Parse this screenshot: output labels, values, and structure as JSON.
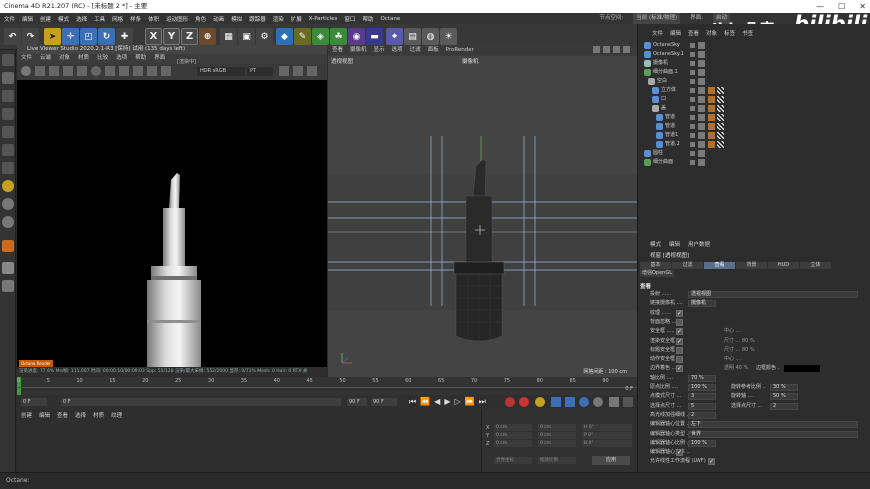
{
  "window": {
    "title": "Cinema 4D R21.207 (RC) - [未标题 2 *] - 主要",
    "controls": [
      "—",
      "☐",
      "✕"
    ]
  },
  "menubar": {
    "items": [
      "文件",
      "编辑",
      "创建",
      "模式",
      "选择",
      "工具",
      "网格",
      "样条",
      "体积",
      "运动图形",
      "角色",
      "动画",
      "模拟",
      "跟踪器",
      "渲染",
      "扩展",
      "X-Particles",
      "窗口",
      "帮助",
      "Octane"
    ],
    "layout_label": "节点空间:",
    "layout_value": "当前 (标准/物理)",
    "interface_label": "界面:",
    "interface_value": "启动"
  },
  "watermark": {
    "brand": "Jidu几度",
    "site": "bilibili"
  },
  "viewer": {
    "title": "Live Viewer Studio 2020.2.1-R3 [保持] 试用 (135 days left)",
    "menu": [
      "文件",
      "云端",
      "对象",
      "材质",
      "比较",
      "选项",
      "帮助",
      "界面"
    ],
    "colorspace": "HDR sRGB",
    "mode": "PT",
    "render_label": "[渲染中]",
    "logo_text": "Octane Render",
    "status": "渲染进度: 77.6%  Ms/帧: 111.007  时间: 00:00:10/00:00:03  Spp: 55/128  渲染/最大采样: 552/2000  显存: 0/71%  Mesh: 0  Hair: 0  RTX:关"
  },
  "editor": {
    "menu": [
      "查看",
      "摄像机",
      "显示",
      "选项",
      "过滤",
      "面板",
      "ProRender"
    ],
    "view_label": "透视视图",
    "camera_label": "摄像机",
    "grid_label": "网格间距 : 100 cm"
  },
  "timeline": {
    "ticks": [
      "0",
      "5",
      "10",
      "15",
      "20",
      "25",
      "30",
      "35",
      "40",
      "45",
      "50",
      "55",
      "60",
      "65",
      "70",
      "75",
      "80",
      "85",
      "90"
    ],
    "frame_end_label": "0 F",
    "start_frame": "0 F",
    "current_frame": "0 F",
    "end_frame_a": "90 F",
    "end_frame_b": "90 F"
  },
  "materials": {
    "menu": [
      "创建",
      "编辑",
      "查看",
      "选择",
      "材质",
      "纹理"
    ]
  },
  "coords": {
    "labels": [
      "X",
      "Y",
      "Z"
    ],
    "pos": [
      "0 cm",
      "0 cm",
      "0 cm"
    ],
    "size": [
      "0 cm",
      "0 cm",
      "0 cm"
    ],
    "rot": [
      "H 0°",
      "P 0°",
      "B 0°"
    ],
    "mode_a": "世界坐标",
    "mode_b": "缩放比例",
    "apply": "应用"
  },
  "objman": {
    "menu": [
      "文件",
      "编辑",
      "查看",
      "对象",
      "标签",
      "书签"
    ],
    "rows": [
      {
        "name": "OctaneSky",
        "indent": 0,
        "icon": "#5b8fd4"
      },
      {
        "name": "OctaneSky.1",
        "indent": 0,
        "icon": "#5b8fd4"
      },
      {
        "name": "摄像机",
        "indent": 0,
        "icon": "#9bb"
      },
      {
        "name": "细分曲面.1",
        "indent": 0,
        "icon": "#5aa05a"
      },
      {
        "name": "空白",
        "indent": 1,
        "icon": "#aaa"
      },
      {
        "name": "立方体",
        "indent": 2,
        "icon": "#5b8fd4"
      },
      {
        "name": "口",
        "indent": 2,
        "icon": "#5b8fd4"
      },
      {
        "name": "盖",
        "indent": 2,
        "icon": "#aaa"
      },
      {
        "name": "管道",
        "indent": 3,
        "icon": "#5b8fd4"
      },
      {
        "name": "管道",
        "indent": 3,
        "icon": "#5b8fd4"
      },
      {
        "name": "管道1",
        "indent": 3,
        "icon": "#5b8fd4"
      },
      {
        "name": "管道.2",
        "indent": 3,
        "icon": "#5b8fd4"
      },
      {
        "name": "圆柱",
        "indent": 0,
        "icon": "#5b8fd4"
      },
      {
        "name": "细分曲面",
        "indent": 0,
        "icon": "#5aa05a"
      }
    ]
  },
  "attrman": {
    "menu": [
      "模式",
      "编辑",
      "用户数据"
    ],
    "header": "视窗 [透视视图]",
    "tabs_row1": [
      "基本",
      "过滤",
      "查看",
      "背景",
      "HUD",
      "立体"
    ],
    "tabs_row2": [
      "增强OpenGL"
    ],
    "active_tab": "查看",
    "section": "查看",
    "rows": [
      {
        "label": "投射 ......",
        "value": "透视视图",
        "type": "select"
      },
      {
        "label": "链接摄像机 ....",
        "value": "摄像机",
        "type": "field"
      },
      {
        "label": "纹理 ......",
        "type": "check",
        "on": true
      },
      {
        "label": "背面忽略 ....",
        "type": "check",
        "on": false
      },
      {
        "label": "安全框 .....",
        "type": "check",
        "on": true,
        "extra": "中心 ...."
      },
      {
        "label": "渲染安全框 ...",
        "type": "check",
        "on": true,
        "extra": "尺寸 ... 80 %"
      },
      {
        "label": "标题安全框 ...",
        "type": "check",
        "on": false,
        "extra": "尺寸 ... 80 %"
      },
      {
        "label": "动作安全框 ...",
        "type": "check",
        "on": false,
        "extra": "中心 ...."
      },
      {
        "label": "边界着色 ....",
        "type": "check",
        "on": true,
        "extra": "透明  40 %",
        "extra2": "边框颜色 ."
      },
      {
        "label": "轴比例 ....",
        "value": "70 %",
        "type": "field"
      },
      {
        "label": "原点比例 ....",
        "value": "100 %",
        "type": "field",
        "label2": "旋转参考比例 ..",
        "value2": "30 %"
      },
      {
        "label": "点模式尺寸 ...",
        "value": "3",
        "type": "field",
        "label2": "旋转轴 ....",
        "value2": "50 %"
      },
      {
        "label": "选择点尺寸 ...",
        "value": "5",
        "type": "field",
        "label2": "选择点尺寸 ...",
        "value2": "2"
      },
      {
        "label": "高光线加强细线 ..",
        "value": "2",
        "type": "field"
      },
      {
        "label": "编辑器轴心位置 ..",
        "value": "左下",
        "type": "select"
      },
      {
        "label": "编辑器轴心类型 ..",
        "value": "世界",
        "type": "select"
      },
      {
        "label": "编辑器轴心比例 ..",
        "value": "100 %",
        "type": "field"
      },
      {
        "label": "编辑器轴心文本 ..",
        "type": "check",
        "on": true
      },
      {
        "label": "允许线性工作流程 (LWF)",
        "type": "check",
        "on": true
      }
    ]
  },
  "statusbar": {
    "text": "Octane:"
  },
  "colors": {
    "accent": "#5a6e8e",
    "active_tool": "#c8a020"
  }
}
